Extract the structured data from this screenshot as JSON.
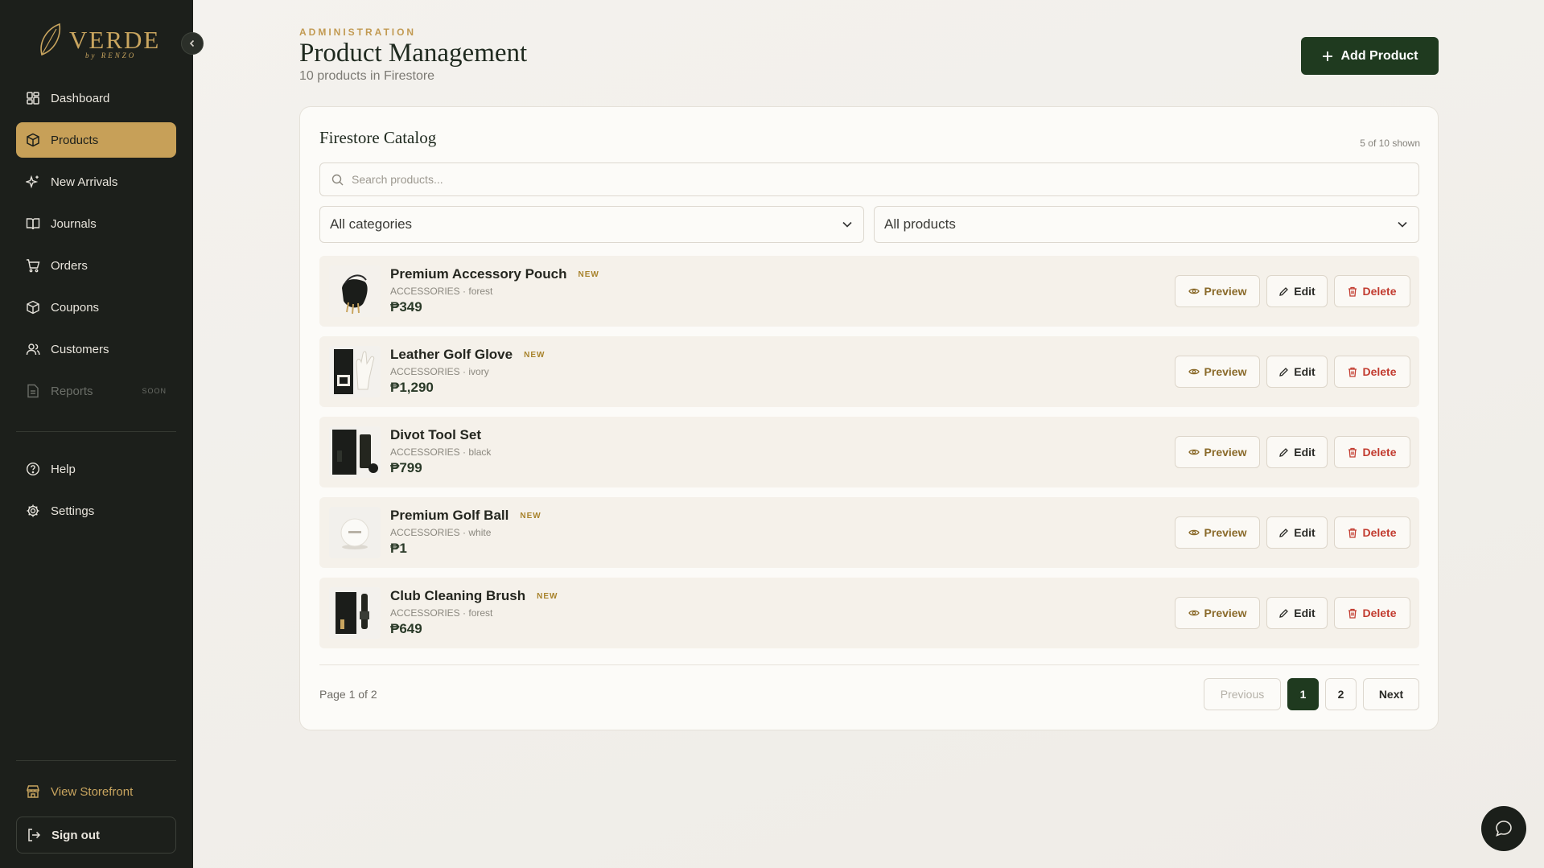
{
  "brand": {
    "name": "VERDE",
    "sub": "by RENZO",
    "gold": "#c9a55f"
  },
  "sidebar": {
    "items": [
      {
        "label": "Dashboard",
        "icon": "dashboard-icon"
      },
      {
        "label": "Products",
        "icon": "box-icon",
        "active": true
      },
      {
        "label": "New Arrivals",
        "icon": "sparkles-icon"
      },
      {
        "label": "Journals",
        "icon": "book-icon"
      },
      {
        "label": "Orders",
        "icon": "cart-icon"
      },
      {
        "label": "Coupons",
        "icon": "tag-icon"
      },
      {
        "label": "Customers",
        "icon": "users-icon"
      },
      {
        "label": "Reports",
        "icon": "report-icon",
        "disabled": true,
        "badge": "SOON"
      }
    ],
    "secondary": [
      {
        "label": "Help",
        "icon": "help-icon"
      },
      {
        "label": "Settings",
        "icon": "gear-icon"
      }
    ],
    "storefront_label": "View Storefront",
    "signout_label": "Sign out"
  },
  "header": {
    "eyebrow": "ADMINISTRATION",
    "title": "Product Management",
    "subtitle": "10 products in Firestore",
    "add_label": "Add Product"
  },
  "catalog": {
    "title": "Firestore Catalog",
    "shown": "5 of 10 shown",
    "search_placeholder": "Search products...",
    "category_filter": "All categories",
    "product_filter": "All products",
    "actions": {
      "preview": "Preview",
      "edit": "Edit",
      "delete": "Delete"
    },
    "products": [
      {
        "name": "Premium Accessory Pouch",
        "badge": "NEW",
        "meta": "ACCESSORIES · forest",
        "price": "₱349"
      },
      {
        "name": "Leather Golf Glove",
        "badge": "NEW",
        "meta": "ACCESSORIES · ivory",
        "price": "₱1,290"
      },
      {
        "name": "Divot Tool Set",
        "badge": "",
        "meta": "ACCESSORIES · black",
        "price": "₱799"
      },
      {
        "name": "Premium Golf Ball",
        "badge": "NEW",
        "meta": "ACCESSORIES · white",
        "price": "₱1"
      },
      {
        "name": "Club Cleaning Brush",
        "badge": "NEW",
        "meta": "ACCESSORIES · forest",
        "price": "₱649"
      }
    ]
  },
  "pagination": {
    "label": "Page 1 of 2",
    "previous": "Previous",
    "pages": [
      "1",
      "2"
    ],
    "current": "1",
    "next": "Next"
  },
  "colors": {
    "primary": "#1f3a1f",
    "accent": "#c7a058",
    "danger": "#c23b2f"
  }
}
